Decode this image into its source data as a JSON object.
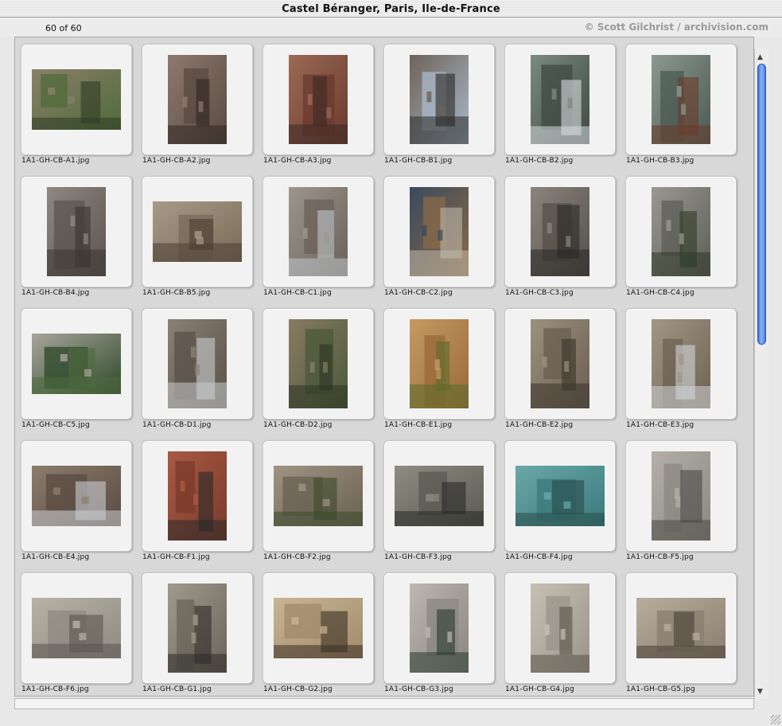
{
  "window": {
    "title": "Castel Béranger, Paris, Ile-de-France",
    "count": "60 of 60",
    "credit": "© Scott Gilchrist / archivision.com"
  },
  "colors": {
    "scroll_thumb": "#4a7ee0",
    "pane_bg": "#d8d8d8",
    "tile_bg": "#f2f2f2"
  },
  "thumbnails": [
    {
      "filename": "1A1-GH-CB-A1.jpg",
      "orientation": "landscape",
      "palette": [
        "#4f6b3a",
        "#8a7f6a",
        "#2e3a24"
      ]
    },
    {
      "filename": "1A1-GH-CB-A2.jpg",
      "orientation": "portrait",
      "palette": [
        "#5a4a42",
        "#8d7a6e",
        "#2f2622"
      ]
    },
    {
      "filename": "1A1-GH-CB-A3.jpg",
      "orientation": "portrait",
      "palette": [
        "#6b3a2e",
        "#9a6a55",
        "#3a2a24"
      ]
    },
    {
      "filename": "1A1-GH-CB-B1.jpg",
      "orientation": "portrait",
      "palette": [
        "#a9b9c9",
        "#6e6258",
        "#2c2a28"
      ]
    },
    {
      "filename": "1A1-GH-CB-B2.jpg",
      "orientation": "portrait",
      "palette": [
        "#3f4a44",
        "#7b8a80",
        "#d8dde0"
      ]
    },
    {
      "filename": "1A1-GH-CB-B3.jpg",
      "orientation": "portrait",
      "palette": [
        "#4a5a52",
        "#8c9890",
        "#6a3a2a"
      ]
    },
    {
      "filename": "1A1-GH-CB-B4.jpg",
      "orientation": "portrait",
      "palette": [
        "#5c5450",
        "#8f8780",
        "#3a3430"
      ]
    },
    {
      "filename": "1A1-GH-CB-B5.jpg",
      "orientation": "landscape",
      "palette": [
        "#7a6a58",
        "#a89a88",
        "#4a3e34"
      ]
    },
    {
      "filename": "1A1-GH-CB-C1.jpg",
      "orientation": "portrait",
      "palette": [
        "#6a625a",
        "#9e968c",
        "#bfc6cc"
      ]
    },
    {
      "filename": "1A1-GH-CB-C2.jpg",
      "orientation": "portrait",
      "palette": [
        "#8a6a48",
        "#3a4a5e",
        "#c0b8a8"
      ]
    },
    {
      "filename": "1A1-GH-CB-C3.jpg",
      "orientation": "portrait",
      "palette": [
        "#55504a",
        "#8a847c",
        "#2a2826"
      ]
    },
    {
      "filename": "1A1-GH-CB-C4.jpg",
      "orientation": "portrait",
      "palette": [
        "#5e5e58",
        "#9a9890",
        "#2e3a28"
      ]
    },
    {
      "filename": "1A1-GH-CB-C5.jpg",
      "orientation": "landscape",
      "palette": [
        "#2e4a2a",
        "#a8a49c",
        "#4e6a3e"
      ]
    },
    {
      "filename": "1A1-GH-CB-D1.jpg",
      "orientation": "portrait",
      "palette": [
        "#5a5248",
        "#8a8074",
        "#c8ccd0"
      ]
    },
    {
      "filename": "1A1-GH-CB-D2.jpg",
      "orientation": "portrait",
      "palette": [
        "#4a5a3a",
        "#8a7a62",
        "#2e3424"
      ]
    },
    {
      "filename": "1A1-GH-CB-E1.jpg",
      "orientation": "portrait",
      "palette": [
        "#9a6a3a",
        "#c49a62",
        "#5a6a2a"
      ]
    },
    {
      "filename": "1A1-GH-CB-E2.jpg",
      "orientation": "portrait",
      "palette": [
        "#6a5e50",
        "#9c907e",
        "#3a342c"
      ]
    },
    {
      "filename": "1A1-GH-CB-E3.jpg",
      "orientation": "portrait",
      "palette": [
        "#6e6252",
        "#a29684",
        "#d0d4d8"
      ]
    },
    {
      "filename": "1A1-GH-CB-E4.jpg",
      "orientation": "landscape",
      "palette": [
        "#5a4a40",
        "#8c7c6c",
        "#c8ccd2"
      ]
    },
    {
      "filename": "1A1-GH-CB-F1.jpg",
      "orientation": "portrait",
      "palette": [
        "#7a3a2a",
        "#a85a44",
        "#2a2a2a"
      ]
    },
    {
      "filename": "1A1-GH-CB-F2.jpg",
      "orientation": "landscape",
      "palette": [
        "#6a6052",
        "#9e9482",
        "#3a4a2a"
      ]
    },
    {
      "filename": "1A1-GH-CB-F3.jpg",
      "orientation": "landscape",
      "palette": [
        "#5a5a52",
        "#8e8c82",
        "#2a2a28"
      ]
    },
    {
      "filename": "1A1-GH-CB-F4.jpg",
      "orientation": "landscape",
      "palette": [
        "#3a7a7a",
        "#6aa8a8",
        "#2a4a4a"
      ]
    },
    {
      "filename": "1A1-GH-CB-F5.jpg",
      "orientation": "portrait",
      "palette": [
        "#8a8882",
        "#b4b0a8",
        "#4a4842"
      ]
    },
    {
      "filename": "1A1-GH-CB-F6.jpg",
      "orientation": "landscape",
      "palette": [
        "#8e8a80",
        "#b8b2a6",
        "#5a5650"
      ]
    },
    {
      "filename": "1A1-GH-CB-G1.jpg",
      "orientation": "portrait",
      "palette": [
        "#6a645a",
        "#a09a8e",
        "#2e2c28"
      ]
    },
    {
      "filename": "1A1-GH-CB-G2.jpg",
      "orientation": "landscape",
      "palette": [
        "#a08a6a",
        "#c8b494",
        "#3a3024"
      ]
    },
    {
      "filename": "1A1-GH-CB-G3.jpg",
      "orientation": "portrait",
      "palette": [
        "#8a8680",
        "#bcb8b0",
        "#2a3a2e"
      ]
    },
    {
      "filename": "1A1-GH-CB-G4.jpg",
      "orientation": "portrait",
      "palette": [
        "#9a948a",
        "#c6c0b4",
        "#5a5448"
      ]
    },
    {
      "filename": "1A1-GH-CB-G5.jpg",
      "orientation": "landscape",
      "palette": [
        "#8a7e70",
        "#b8ac9c",
        "#4a4036"
      ]
    }
  ]
}
